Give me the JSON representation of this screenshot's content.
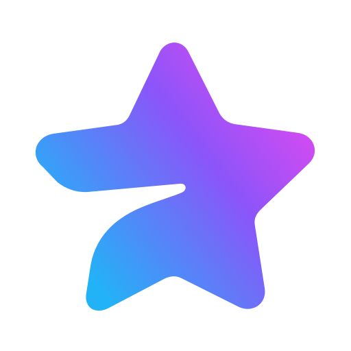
{
  "icon": {
    "name": "premium-star-icon",
    "shape": "star",
    "gradient": {
      "start": "#22b3f7",
      "middle": "#8b55f9",
      "end": "#d64af2"
    },
    "background": "#ffffff"
  }
}
